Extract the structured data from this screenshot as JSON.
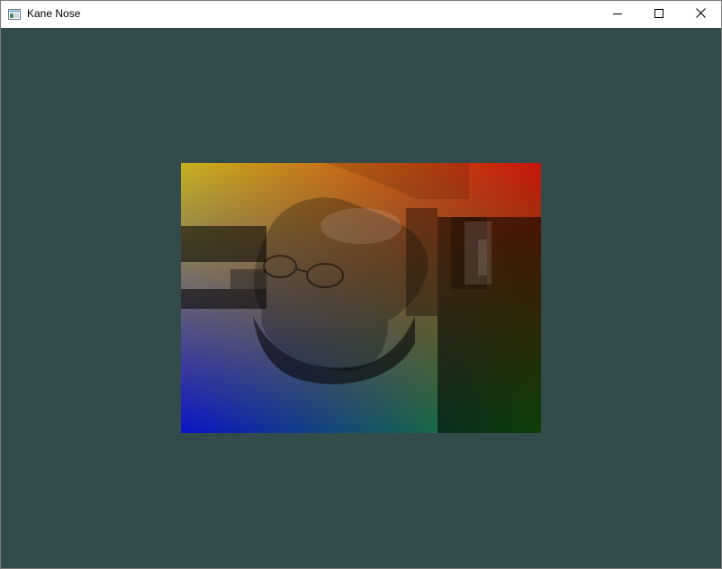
{
  "window": {
    "title": "Kane Nose",
    "app_icon": "window-app-icon",
    "controls": [
      "minimize-icon",
      "maximize-icon",
      "close-icon"
    ]
  },
  "scene": {
    "background_color": "#344b4c",
    "corner_colors": {
      "top_left": "#c8b21e",
      "top_right": "#c8140a",
      "bottom_left": "#0a14c8",
      "bottom_right": "#1e8c14"
    },
    "texture": "photo-of-man-upside-down",
    "orientation": "flipped-vertical"
  }
}
